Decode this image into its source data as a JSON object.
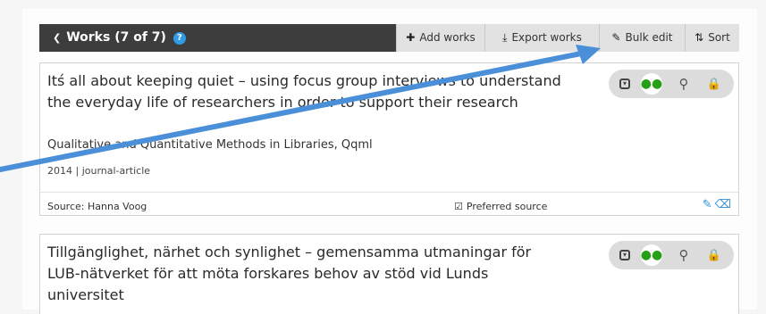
{
  "header": {
    "title": "Works (7 of 7)",
    "help_glyph": "?",
    "toolbar": {
      "add_works": "Add works",
      "export_works": "Export works",
      "bulk_edit": "Bulk edit",
      "sort": "Sort"
    }
  },
  "works": [
    {
      "title": "Itś all about keeping quiet – using focus group interviews to understand the everyday life of researchers in order to support their research",
      "journal": "Qualitative and Quantitative Methods in Libraries, Qqml",
      "meta": "2014 | journal-article",
      "source": "Source: Hanna Voog",
      "preferred": "Preferred source"
    },
    {
      "title": "Tillgänglighet, närhet och synlighet – gemensamma utmaningar för LUB-nätverket för att möta forskares behov av stöd vid Lunds universitet"
    }
  ],
  "colors": {
    "header_bg": "#3d3d3d",
    "toolbar_bg": "#e2e2e2",
    "accent_blue": "#2f8fd6",
    "arrow": "#4a8fd8",
    "people_green": "#26a017"
  },
  "icons": [
    "chevron-down-icon",
    "help-icon",
    "plus-icon",
    "download-icon",
    "pencil-icon",
    "sort-icon",
    "expand-icon",
    "people-icon",
    "key-icon",
    "lock-icon",
    "check-icon",
    "trash-icon"
  ]
}
